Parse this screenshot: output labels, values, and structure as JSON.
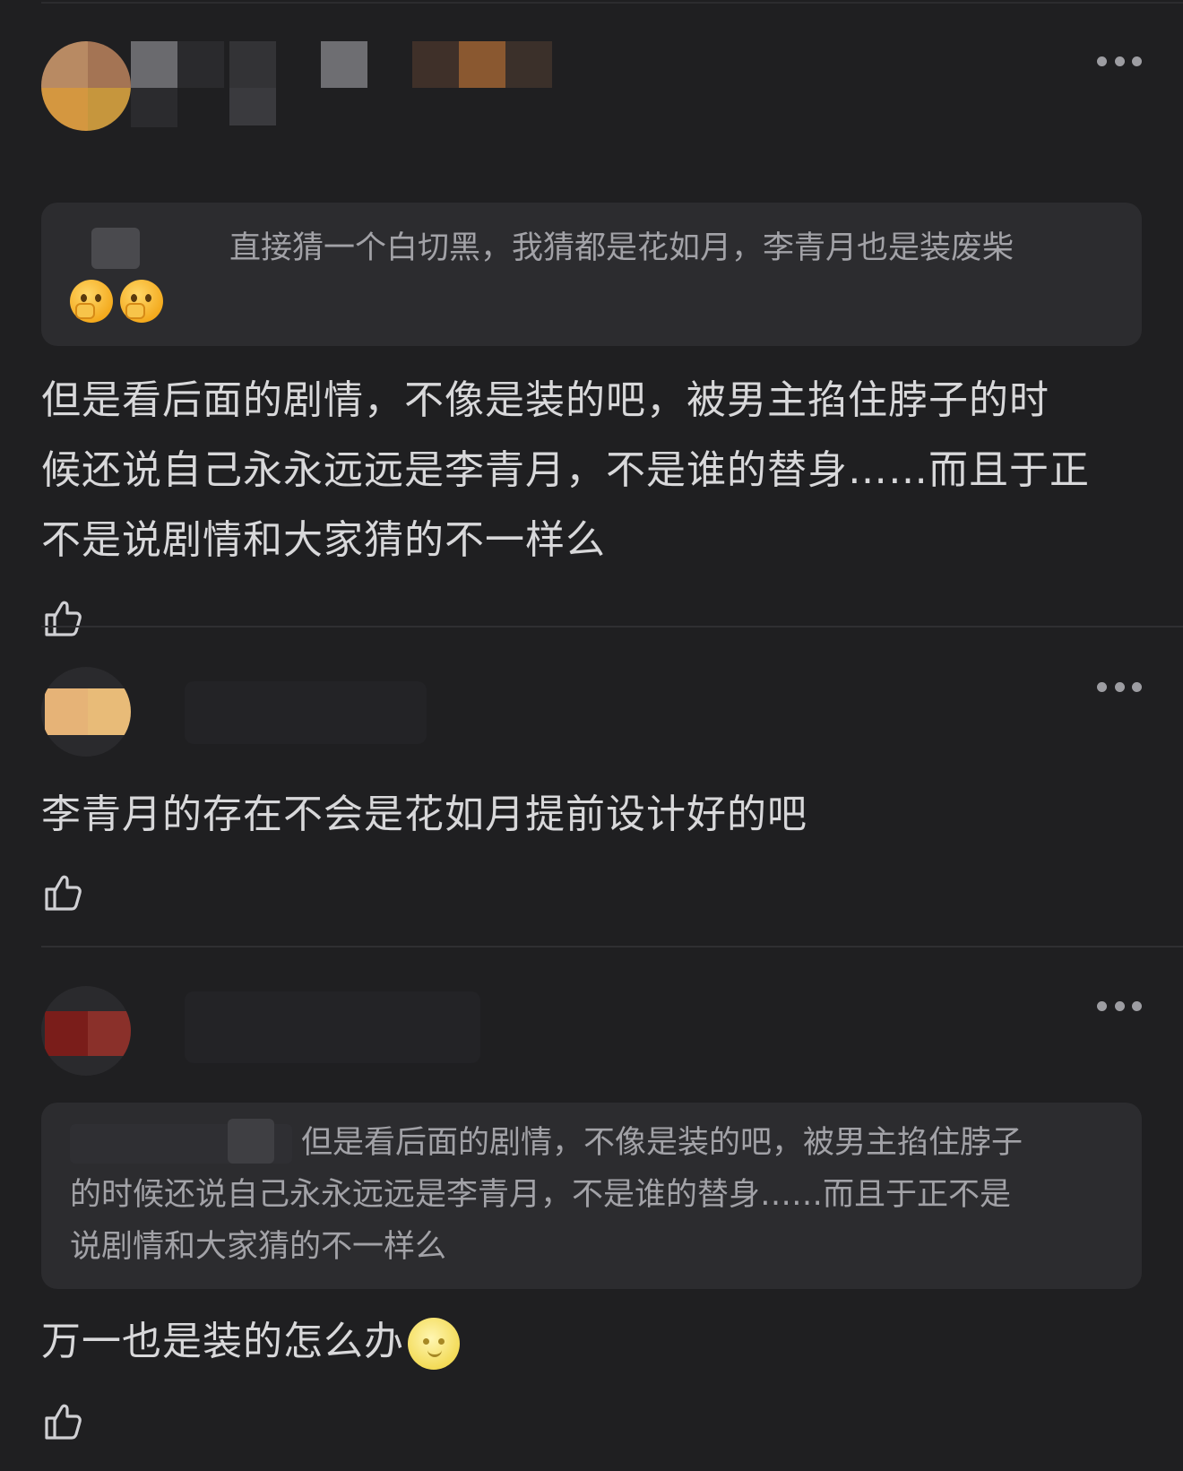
{
  "comments": [
    {
      "quote": {
        "text": "直接猜一个白切黑，我猜都是花如月，李青月也是装废柴",
        "emoji": [
          "thinking-face-emoji",
          "thinking-face-emoji"
        ]
      },
      "body": [
        "但是看后面的剧情，不像是装的吧，被男主掐住脖子的时",
        "候还说自己永永远远是李青月，不是谁的替身……而且于正",
        "不是说剧情和大家猜的不一样么"
      ]
    },
    {
      "body": [
        "李青月的存在不会是花如月提前设计好的吧"
      ]
    },
    {
      "quote": {
        "text": "但是看后面的剧情，不像是装的吧，被男主掐住脖子",
        "lines": [
          "的时候还说自己永永远远是李青月，不是谁的替身……而且于正不是",
          "说剧情和大家猜的不一样么"
        ]
      },
      "body": [
        "万一也是装的怎么办"
      ],
      "body_emoji": "full-moon-face-emoji"
    }
  ],
  "colors": {
    "background": "#1f1f21",
    "quote_background": "#2c2c2f",
    "body_text": "#d8d8da",
    "quote_text": "#a2a2a7",
    "icon": "#9d9da2"
  },
  "icons": [
    "more-options-icon",
    "thumbs-up-icon"
  ]
}
